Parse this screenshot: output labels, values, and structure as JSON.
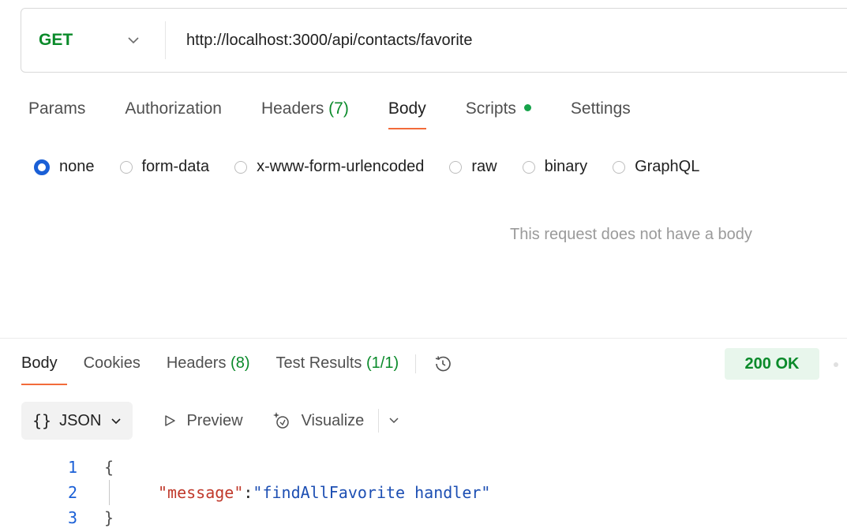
{
  "request": {
    "method": "GET",
    "url": "http://localhost:3000/api/contacts/favorite"
  },
  "request_tabs": [
    {
      "label": "Params"
    },
    {
      "label": "Authorization"
    },
    {
      "label": "Headers",
      "count": "(7)"
    },
    {
      "label": "Body"
    },
    {
      "label": "Scripts"
    },
    {
      "label": "Settings"
    }
  ],
  "body_types": [
    "none",
    "form-data",
    "x-www-form-urlencoded",
    "raw",
    "binary",
    "GraphQL"
  ],
  "selected_body_type": "none",
  "empty_body_message": "This request does not have a body",
  "response": {
    "tabs": [
      {
        "label": "Body"
      },
      {
        "label": "Cookies"
      },
      {
        "label": "Headers",
        "count": "(8)"
      },
      {
        "label": "Test Results",
        "count": "(1/1)"
      }
    ],
    "status": "200 OK",
    "format": {
      "braces": "{}",
      "label": "JSON",
      "preview_label": "Preview",
      "visualize_label": "Visualize"
    },
    "code_lines": {
      "n1": "1",
      "open": "{",
      "n2": "2",
      "key": "\"message\"",
      "colon": ": ",
      "value": "\"findAllFavorite handler\"",
      "n3": "3",
      "close": "}"
    }
  },
  "colors": {
    "method_green": "#0a8a2a",
    "accent_orange": "#f26b3a",
    "radio_blue": "#1a5fd6",
    "status_bg": "#e8f6ec"
  }
}
